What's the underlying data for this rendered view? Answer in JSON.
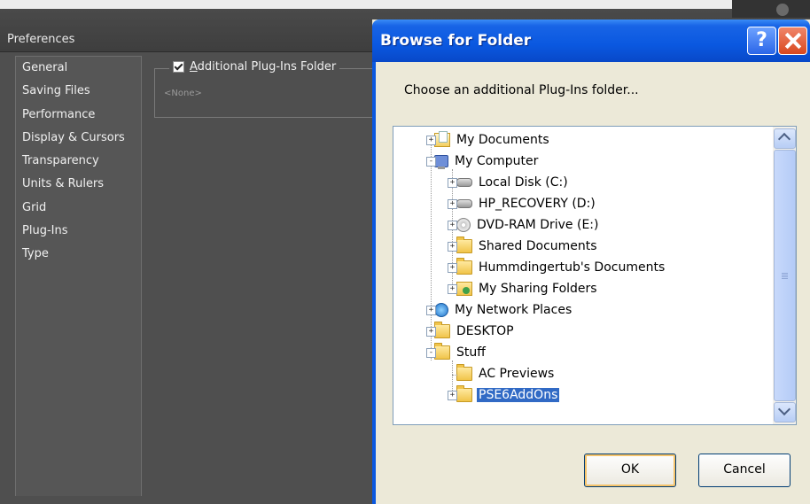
{
  "preferences": {
    "title": "Preferences",
    "sidebar": {
      "items": [
        "General",
        "Saving Files",
        "Performance",
        "Display & Cursors",
        "Transparency",
        "Units & Rulers",
        "Grid",
        "Plug-Ins",
        "Type"
      ]
    },
    "plugins_group": {
      "checkbox_checked": true,
      "label_accel": "A",
      "label_rest": "dditional Plug-Ins Folder",
      "path": "<None>"
    }
  },
  "dialog": {
    "title": "Browse for Folder",
    "help_icon": "?",
    "description": "Choose an additional Plug-Ins folder...",
    "tree": [
      {
        "label": "My Documents",
        "icon": "docs-icon",
        "toggle": "+"
      },
      {
        "label": "My Computer",
        "icon": "computer-icon",
        "toggle": "-"
      },
      {
        "label": "Local Disk (C:)",
        "icon": "disk-icon",
        "toggle": "+"
      },
      {
        "label": "HP_RECOVERY (D:)",
        "icon": "disk-icon",
        "toggle": "+"
      },
      {
        "label": "DVD-RAM Drive (E:)",
        "icon": "dvd-icon",
        "toggle": "+"
      },
      {
        "label": "Shared Documents",
        "icon": "folder-icon",
        "toggle": "+"
      },
      {
        "label": "Hummdingertub's Documents",
        "icon": "folder-icon",
        "toggle": "+"
      },
      {
        "label": "My Sharing Folders",
        "icon": "sharing-icon",
        "toggle": "+"
      },
      {
        "label": "My Network Places",
        "icon": "network-icon",
        "toggle": "+"
      },
      {
        "label": "DESKTOP",
        "icon": "folder-icon",
        "toggle": "+"
      },
      {
        "label": "Stuff",
        "icon": "folder-icon",
        "toggle": "-"
      },
      {
        "label": "AC Previews",
        "icon": "folder-icon",
        "toggle": ""
      },
      {
        "label": "PSE6AddOns",
        "icon": "folder-icon",
        "toggle": "+",
        "selected": true
      }
    ],
    "ok_label": "OK",
    "cancel_label": "Cancel"
  },
  "colors": {
    "selection": "#316ac5",
    "titlebar_blue": "#0a58e0",
    "preferences_bg": "#4f4f4f"
  }
}
